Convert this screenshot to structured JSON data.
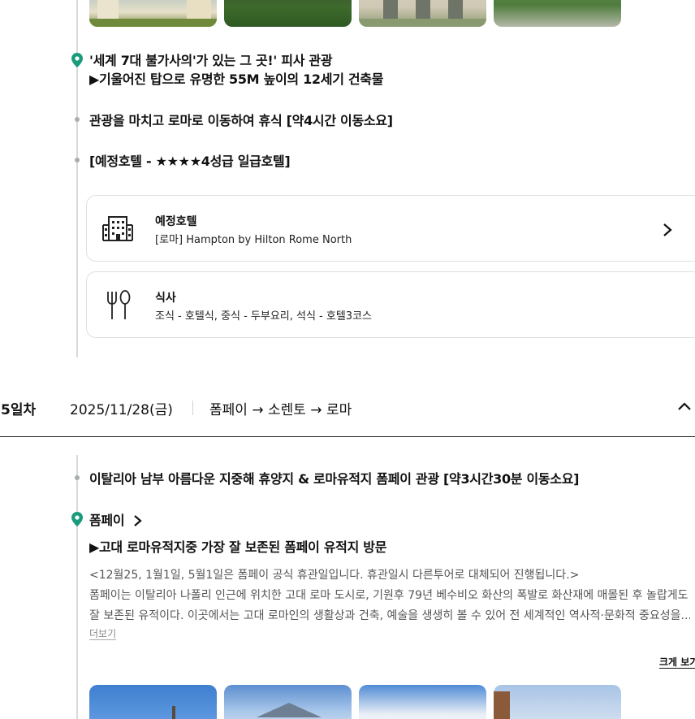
{
  "day4": {
    "stops": [
      {
        "title": "'세계 7대 불가사의'가 있는 그 곳!' 피사 관광",
        "subtitle": "▶기울어진 탑으로 유명한 55M 높이의 12세기 건축물"
      },
      {
        "title": "관광을 마치고 로마로 이동하여 휴식 [약4시간 이동소요]"
      },
      {
        "title": "[예정호텔 - ★★★★4성급 일급호텔]"
      }
    ],
    "hotel_card": {
      "title": "예정호텔",
      "subtitle": "[로마] Hampton by Hilton Rome North"
    },
    "meal_card": {
      "title": "식사",
      "subtitle": "조식 - 호텔식, 중식 - 두부요리, 석식 - 호텔3코스"
    }
  },
  "day5": {
    "day_label": "5일차",
    "date": "2025/11/28(금)",
    "route": "폼페이 → 소렌토 → 로마",
    "stops": [
      {
        "title": "이탈리아 남부 아름다운 지중해 휴양지 & 로마유적지 폼페이 관광 [약3시간30분 이동소요]"
      },
      {
        "title": "폼페이"
      }
    ],
    "highlight": "▶고대 로마유적지중 가장 잘 보존된 폼페이 유적지 방문",
    "desc_lines": [
      "<12월25, 1월1일, 5월1일은 폼페이 공식 휴관일입니다. 휴관일시 다른투어로 대체되어 진행됩니다.>",
      "폼페이는 이탈리아 나폴리 인근에 위치한 고대 로마 도시로, 기원후 79년 베수비오 화산의 폭발로 화산재에 매몰된 후 놀랍게도",
      "잘 보존된 유적이다. 이곳에서는 고대 로마인의 생활상과 건축, 예술을 생생히 볼 수 있어 전 세계적인 역사적·문화적 중요성을..."
    ],
    "more_label": "더보기",
    "big_view_label": "크게 보기"
  },
  "colors": {
    "accent": "#1a9b7b",
    "dot": "#a7aeab",
    "line": "#d6dad8"
  }
}
